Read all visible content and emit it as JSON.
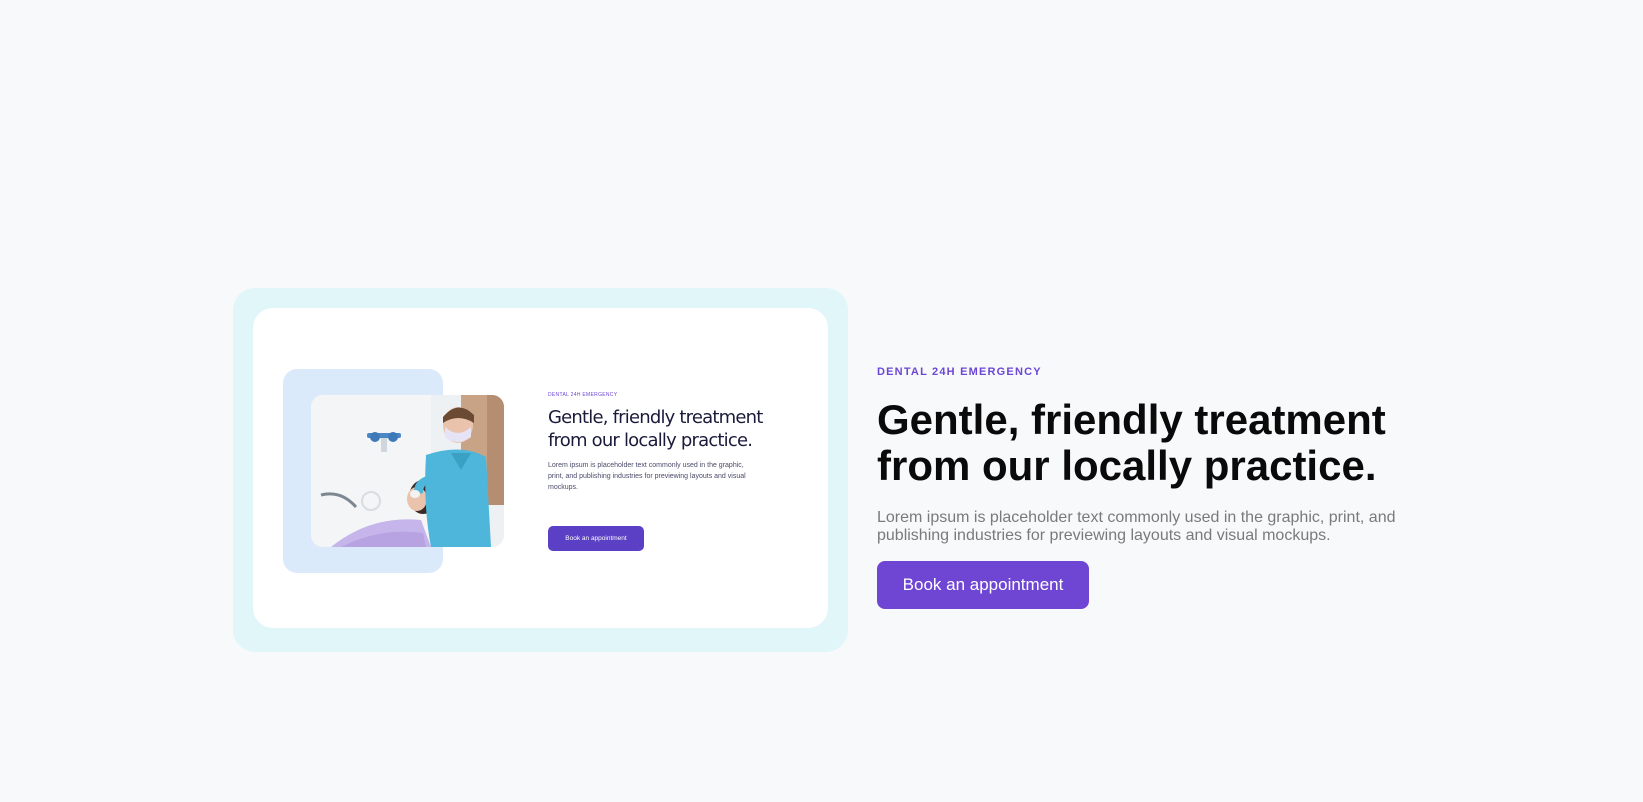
{
  "preview": {
    "eyebrow": "DENTAL 24H EMERGENCY",
    "heading": "Gentle, friendly treatment from our locally practice.",
    "body": "Lorem ipsum is placeholder text commonly used in the graphic, print, and publishing industries for previewing layouts and visual mockups.",
    "button_label": "Book an appointment",
    "photo_icon": "dentist-patient-photo"
  },
  "hero": {
    "eyebrow": "DENTAL 24H EMERGENCY",
    "heading": "Gentle, friendly treatment from our locally practice.",
    "body": "Lorem ipsum is placeholder text commonly used in the graphic, print, and publishing industries for previewing layouts and visual mockups.",
    "button_label": "Book an appointment"
  },
  "colors": {
    "page_background": "#f8f9fb",
    "card_outer": "#e1f6f9",
    "card_inner": "#ffffff",
    "photo_backdrop": "#dbeafa",
    "accent": "#6f45d4",
    "heading": "#0a0a0a",
    "body_text": "#7a7a7a"
  }
}
